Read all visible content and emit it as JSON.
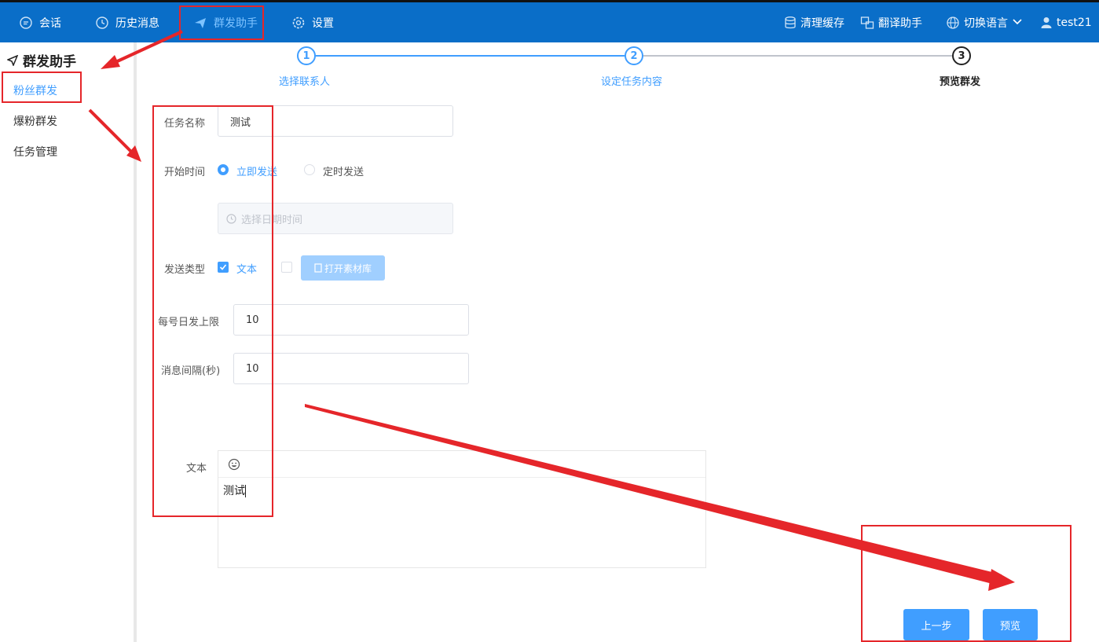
{
  "nav": {
    "chat": "会话",
    "history": "历史消息",
    "broadcast": "群发助手",
    "settings": "设置",
    "clear_cache": "清理缓存",
    "translate": "翻译助手",
    "language": "切换语言",
    "user": "test21"
  },
  "sidebar": {
    "title": "群发助手",
    "items": [
      {
        "label": "粉丝群发"
      },
      {
        "label": "爆粉群发"
      },
      {
        "label": "任务管理"
      }
    ]
  },
  "steps": [
    {
      "num": "1",
      "label": "选择联系人"
    },
    {
      "num": "2",
      "label": "设定任务内容"
    },
    {
      "num": "3",
      "label": "预览群发"
    }
  ],
  "form": {
    "task_name_label": "任务名称",
    "task_name_value": "测试",
    "start_time_label": "开始时间",
    "start_now": "立即发送",
    "start_scheduled": "定时发送",
    "date_placeholder": "选择日期时间",
    "send_type_label": "发送类型",
    "type_text": "文本",
    "open_library": "打开素材库",
    "daily_limit_label": "每号日发上限",
    "daily_limit_value": "10",
    "interval_label": "消息间隔(秒)",
    "interval_value": "10",
    "text_label": "文本",
    "text_content": "测试"
  },
  "buttons": {
    "prev": "上一步",
    "preview": "预览"
  },
  "colors": {
    "topbar": "#0a6ec8",
    "accent": "#409eff",
    "annotation": "#e5262a"
  }
}
